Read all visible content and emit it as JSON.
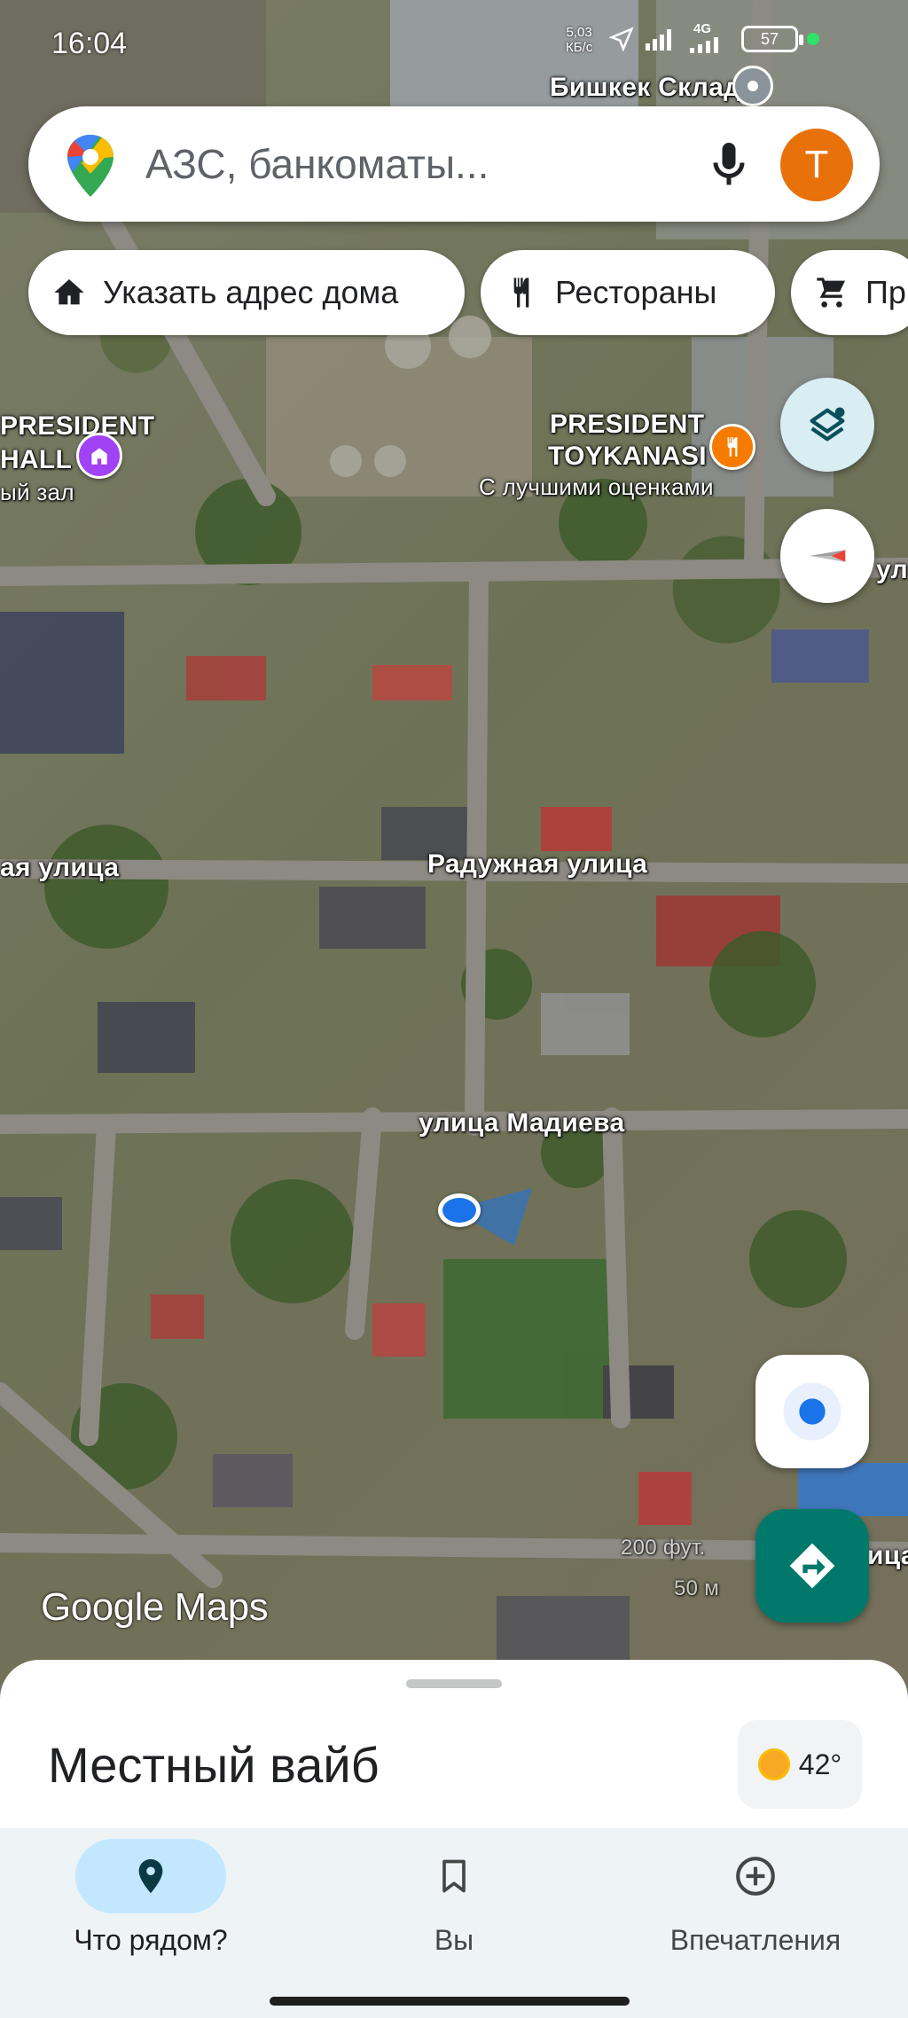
{
  "status_bar": {
    "time": "16:04",
    "net_speed_value": "5,03",
    "net_speed_unit": "КБ/с",
    "network": "4G",
    "battery": "57"
  },
  "search": {
    "placeholder": "АЗС, банкоматы...",
    "avatar_letter": "Т"
  },
  "chips": [
    {
      "label": "Указать адрес дома",
      "icon": "home-icon"
    },
    {
      "label": "Рестораны",
      "icon": "restaurant-icon"
    },
    {
      "label": "Пр",
      "icon": "shopping-cart-icon"
    }
  ],
  "map": {
    "labels": {
      "warehouse": "Бишкек Склад",
      "president_hall_line1": "PRESIDENT",
      "president_hall_line2": "HALL",
      "hall_subtitle": "ый зал",
      "toykanasi_line1": "PRESIDENT",
      "toykanasi_line2": "TOYKANASI",
      "toykanasi_subtitle": "С лучшими оценками",
      "street_left": "ая улица",
      "street_raduzhnaya": "Радужная улица",
      "street_madieva": "улица Мадиева",
      "street_right_top": "ул",
      "street_right_bottom": "ица",
      "scale_feet": "200 фут.",
      "scale_meters": "50 м",
      "watermark": "Google Maps"
    },
    "accent_colors": {
      "location_blue": "#1a73e8",
      "directions_teal": "#00796b",
      "restaurant_orange": "#f57c00",
      "hall_purple": "#a142f4"
    }
  },
  "sheet": {
    "title": "Местный вайб",
    "temperature": "42°"
  },
  "bottom_nav": [
    {
      "label": "Что рядом?",
      "icon": "location-pin-icon",
      "active": true
    },
    {
      "label": "Вы",
      "icon": "bookmark-icon",
      "active": false
    },
    {
      "label": "Впечатления",
      "icon": "add-circle-icon",
      "active": false
    }
  ]
}
